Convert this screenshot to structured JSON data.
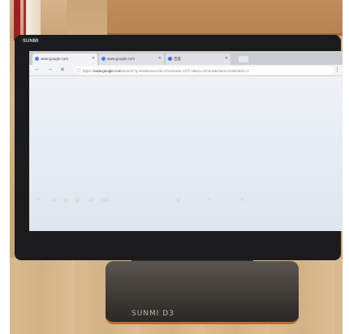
{
  "device": {
    "brand": "SUNMI",
    "base_logo": "SUNMI D3"
  },
  "browser": {
    "tabs": [
      {
        "title": "www.google.com",
        "active": true
      },
      {
        "title": "www.google.com",
        "active": false
      },
      {
        "title": "百度",
        "active": false
      }
    ],
    "address": {
      "scheme": "https://",
      "host": "www.google.com",
      "path": "/search?q=test&sourceid=chrome&ie=UTF-8&oq=chrome&client=mobile&rlz=1"
    }
  },
  "icons": {
    "back": "arrow-left-icon",
    "forward": "arrow-right-icon",
    "stop": "close-icon",
    "info": "info-icon",
    "menu": "more-vert-icon"
  }
}
